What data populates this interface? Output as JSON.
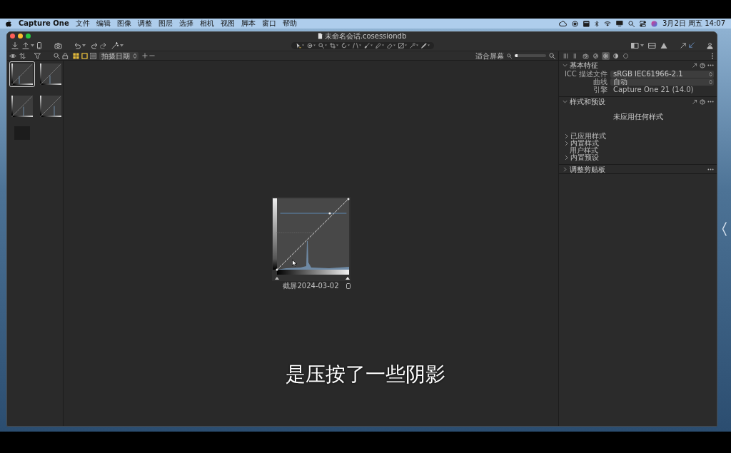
{
  "menu_bar": {
    "items": [
      {
        "label": "Capture One",
        "kind": "app"
      },
      {
        "label": "文件",
        "kind": "menu"
      },
      {
        "label": "编辑",
        "kind": "menu"
      },
      {
        "label": "图像",
        "kind": "menu"
      },
      {
        "label": "调整",
        "kind": "menu"
      },
      {
        "label": "图层",
        "kind": "menu"
      },
      {
        "label": "选择",
        "kind": "menu"
      },
      {
        "label": "相机",
        "kind": "menu"
      },
      {
        "label": "视图",
        "kind": "menu"
      },
      {
        "label": "脚本",
        "kind": "menu"
      },
      {
        "label": "窗口",
        "kind": "menu"
      },
      {
        "label": "帮助",
        "kind": "menu"
      }
    ],
    "clock": "3月2日 周五 14:07"
  },
  "window": {
    "title": "未命名会话.cosessiondb"
  },
  "browser": {
    "sort": "拍摄日期",
    "thumbnails": [
      {
        "kind": "screenshot",
        "selected": true
      },
      {
        "kind": "screenshot",
        "selected": false
      },
      {
        "kind": "screenshot",
        "selected": false
      },
      {
        "kind": "screenshot",
        "selected": false
      },
      {
        "kind": "photo",
        "selected": false
      }
    ]
  },
  "viewer": {
    "zoom": {
      "label": "适合屏幕",
      "level": 0.1
    },
    "image": {
      "caption": "截屏2024-03-02"
    }
  },
  "tool_tabs": [
    {
      "selected": false
    },
    {
      "selected": false
    },
    {
      "selected": false
    },
    {
      "selected": false
    },
    {
      "selected": true
    },
    {
      "selected": false
    },
    {
      "selected": false
    }
  ],
  "sections": [
    {
      "title": "基本特征",
      "expanded": true,
      "rows": [
        {
          "label": "ICC 描述文件",
          "value": "sRGB IEC61966-2.1",
          "kind": "dropdown"
        },
        {
          "label": "曲线",
          "value": "自动",
          "kind": "dropdown"
        },
        {
          "label": "引擎",
          "value": "Capture One 21 (14.0)",
          "kind": "text"
        }
      ]
    },
    {
      "title": "样式和预设",
      "expanded": true,
      "message": "未应用任何样式",
      "items": [
        {
          "label": "已应用样式",
          "expandable": true
        },
        {
          "label": "内置样式",
          "expandable": true
        },
        {
          "label": "用户样式",
          "expandable": false
        },
        {
          "label": "内置预设",
          "expandable": true
        }
      ]
    },
    {
      "title": "调整剪贴板",
      "expanded": false
    }
  ],
  "subtitle": "是压按了一些阴影"
}
